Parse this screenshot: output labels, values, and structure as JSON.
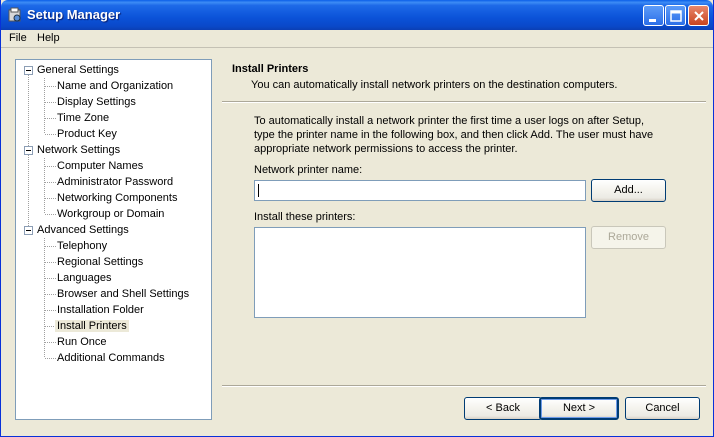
{
  "window": {
    "title": "Setup Manager"
  },
  "menu": {
    "file": "File",
    "help": "Help"
  },
  "tree": {
    "groups": [
      {
        "label": "General Settings",
        "items": [
          "Name and Organization",
          "Display Settings",
          "Time Zone",
          "Product Key"
        ]
      },
      {
        "label": "Network Settings",
        "items": [
          "Computer Names",
          "Administrator Password",
          "Networking Components",
          "Workgroup or Domain"
        ]
      },
      {
        "label": "Advanced Settings",
        "items": [
          "Telephony",
          "Regional Settings",
          "Languages",
          "Browser and Shell Settings",
          "Installation Folder",
          "Install Printers",
          "Run Once",
          "Additional Commands"
        ]
      }
    ],
    "selected": "Install Printers"
  },
  "page": {
    "title": "Install Printers",
    "description": "You can automatically install network printers on the destination computers.",
    "instructions": "To automatically install a network printer the first time a user logs on after Setup, type the printer name in the following box, and then click Add. The user must have appropriate network permissions to access the printer.",
    "printer_name_label": "Network printer name:",
    "printer_name_value": "",
    "install_list_label": "Install these printers:",
    "add_button": "Add...",
    "remove_button": "Remove"
  },
  "footer": {
    "back": "< Back",
    "next": "Next >",
    "cancel": "Cancel"
  }
}
